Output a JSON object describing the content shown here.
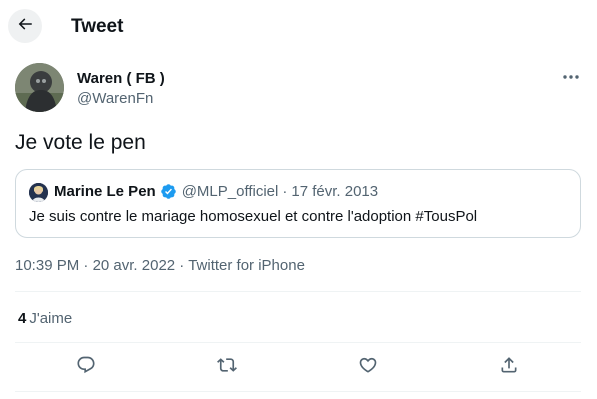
{
  "header": {
    "title": "Tweet",
    "back_icon": "arrow-left-icon"
  },
  "tweet": {
    "author": {
      "display_name": "Waren ( FB )",
      "handle": "@WarenFn"
    },
    "more_icon": "more-dots-icon",
    "text": "Je vote le pen",
    "quote": {
      "author_name": "Marine Le Pen",
      "verified_icon": "verified-badge-icon",
      "handle": "@MLP_officiel",
      "separator": "·",
      "date": "17 févr. 2013",
      "text": "Je suis contre le mariage homosexuel et contre l'adoption #TousPol"
    },
    "meta": {
      "time": "10:39 PM",
      "separator": " · ",
      "date": "20 avr. 2022",
      "source": "Twitter for iPhone"
    },
    "stats": {
      "likes_count": "4",
      "likes_label": "J'aime"
    },
    "actions": [
      {
        "name": "reply",
        "icon": "reply-icon"
      },
      {
        "name": "retweet",
        "icon": "retweet-icon"
      },
      {
        "name": "like",
        "icon": "heart-icon"
      },
      {
        "name": "share",
        "icon": "share-icon"
      }
    ]
  },
  "colors": {
    "text_primary": "#0f1419",
    "text_secondary": "#536471",
    "border": "#cfd9de",
    "divider": "#eff3f4",
    "verified": "#1d9bf0"
  }
}
